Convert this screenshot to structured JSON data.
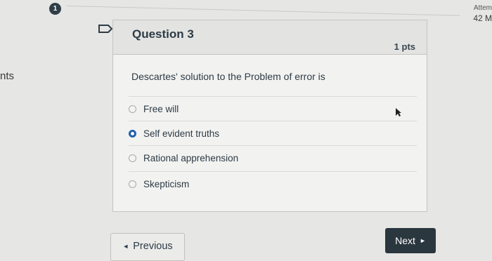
{
  "header": {
    "badge_count": "1",
    "attempt_label": "Attem",
    "attempt_time": "42 M",
    "left_fragment": "nts"
  },
  "question": {
    "title": "Question 3",
    "points": "1 pts",
    "text": "Descartes' solution to the Problem of error is",
    "answers": [
      {
        "label": "Free will",
        "selected": false
      },
      {
        "label": "Self evident truths",
        "selected": true
      },
      {
        "label": "Rational apprehension",
        "selected": false
      },
      {
        "label": "Skepticism",
        "selected": false
      }
    ]
  },
  "nav": {
    "previous_label": "Previous",
    "next_label": "Next"
  },
  "colors": {
    "selected_radio": "#1f5fb4",
    "next_button": "#2b373f"
  },
  "icons": {
    "flag": "flag-icon",
    "prev_arrow": "◄",
    "next_arrow": "►"
  }
}
